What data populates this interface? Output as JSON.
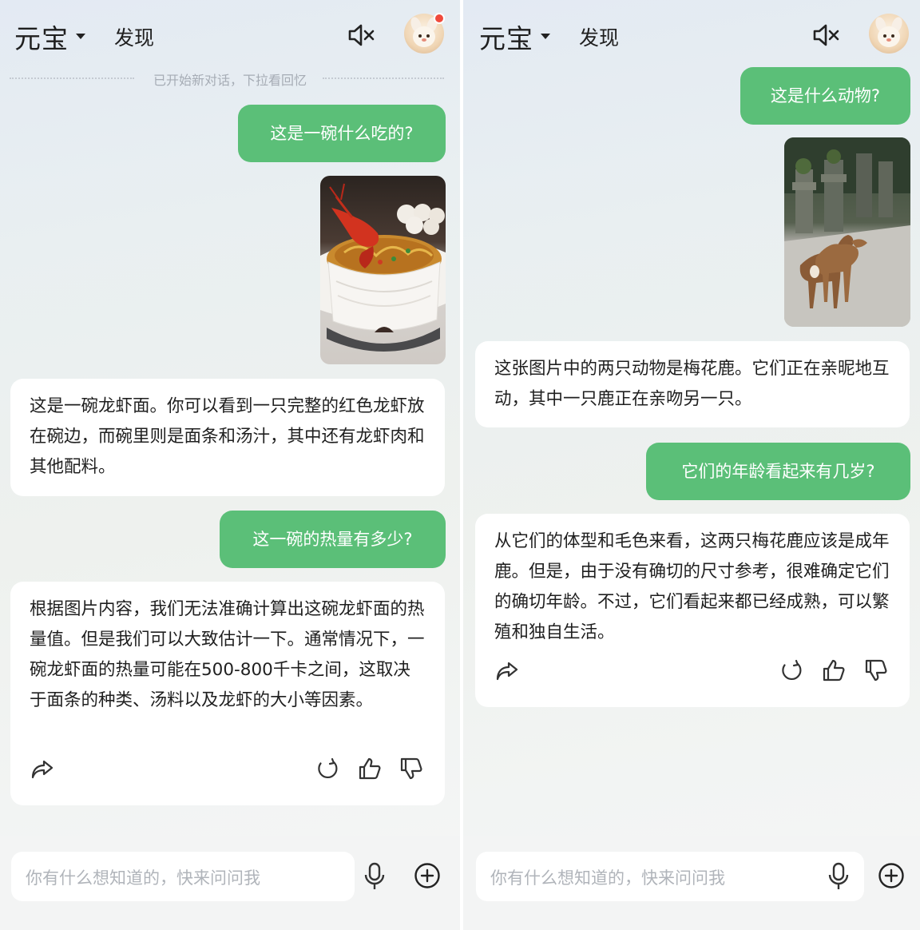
{
  "colors": {
    "user_bubble": "#5bbf78",
    "ai_bubble": "#ffffff",
    "accent_dot": "#f04a3c"
  },
  "icons": [
    "chevron-down-icon",
    "mute-icon",
    "avatar",
    "share-icon",
    "regenerate-icon",
    "thumbs-up-icon",
    "thumbs-down-icon",
    "mic-icon",
    "plus-icon"
  ],
  "left": {
    "header": {
      "title": "元宝",
      "discover": "发现"
    },
    "divider": "已开始新对话，下拉看回忆",
    "messages": {
      "q1": "这是一碗什么吃的?",
      "a1": "这是一碗龙虾面。你可以看到一只完整的红色龙虾放在碗边，而碗里则是面条和汤汁，其中还有龙虾肉和其他配料。",
      "q2": "这一碗的热量有多少?",
      "a2": "根据图片内容，我们无法准确计算出这碗龙虾面的热量值。但是我们可以大致估计一下。通常情况下，一碗龙虾面的热量可能在500-800千卡之间，这取决于面条的种类、汤料以及龙虾的大小等因素。"
    },
    "input_placeholder": "你有什么想知道的，快来问问我"
  },
  "right": {
    "header": {
      "title": "元宝",
      "discover": "发现"
    },
    "messages": {
      "q1": "这是什么动物?",
      "a1": "这张图片中的两只动物是梅花鹿。它们正在亲昵地互动，其中一只鹿正在亲吻另一只。",
      "q2": "它们的年龄看起来有几岁?",
      "a2": "从它们的体型和毛色来看，这两只梅花鹿应该是成年鹿。但是，由于没有确切的尺寸参考，很难确定它们的确切年龄。不过，它们看起来都已经成熟，可以繁殖和独自生活。"
    },
    "input_placeholder": "你有什么想知道的，快来问问我"
  }
}
